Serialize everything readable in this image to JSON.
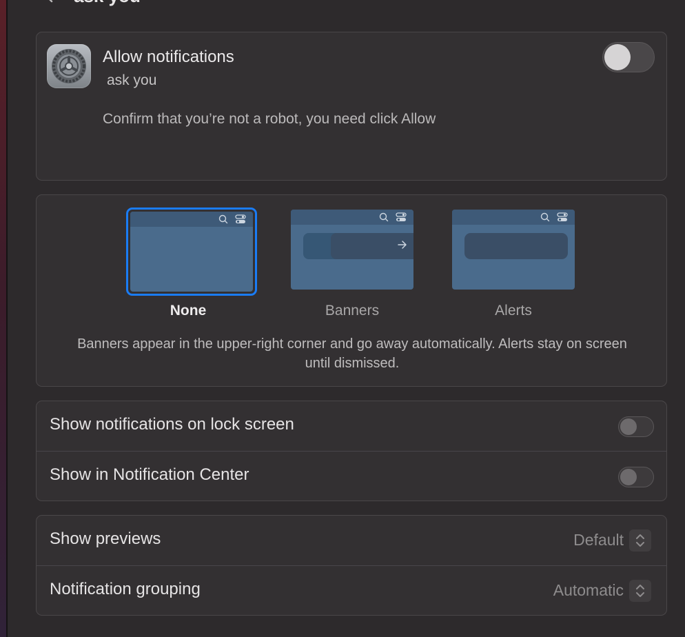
{
  "header": {
    "title": "ask you"
  },
  "app_card": {
    "title": "Allow notifications",
    "subtitle": "ask you",
    "description": "Confirm that you’re not a robot, you need click Allow",
    "toggle_on": false,
    "icon": "system-settings-gear-icon"
  },
  "alert_style": {
    "options": [
      {
        "label": "None",
        "selected": true
      },
      {
        "label": "Banners",
        "selected": false
      },
      {
        "label": "Alerts",
        "selected": false
      }
    ],
    "description": "Banners appear in the upper-right corner and go away automatically. Alerts stay on screen until dismissed.",
    "accent": "#1a7cf5"
  },
  "toggles": [
    {
      "label": "Show notifications on lock screen",
      "on": false
    },
    {
      "label": "Show in Notification Center",
      "on": false
    }
  ],
  "selects": [
    {
      "label": "Show previews",
      "value": "Default"
    },
    {
      "label": "Notification grouping",
      "value": "Automatic"
    }
  ]
}
